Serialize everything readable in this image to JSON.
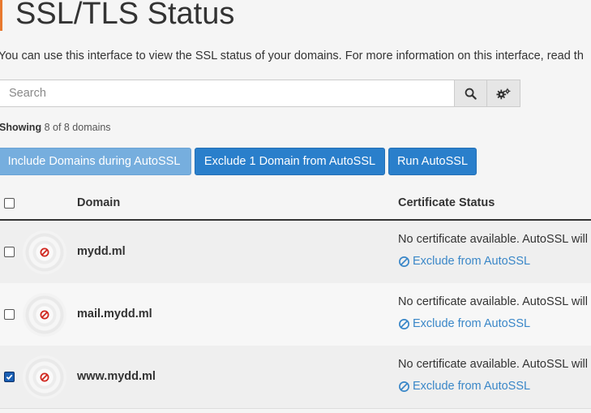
{
  "page": {
    "title": "SSL/TLS Status",
    "intro": "You can use this interface to view the SSL status of your domains. For more information on this interface, read th"
  },
  "search": {
    "placeholder": "Search",
    "search_icon": "search-icon",
    "settings_icon": "gears-icon"
  },
  "summary": {
    "label": "Showing",
    "count": "8 of 8 domains"
  },
  "actions": {
    "include": "Include Domains during AutoSSL",
    "exclude": "Exclude 1 Domain from AutoSSL",
    "run": "Run AutoSSL"
  },
  "table": {
    "headers": {
      "domain": "Domain",
      "status": "Certificate Status"
    },
    "rows": [
      {
        "domain": "mydd.ml",
        "status": "No certificate available. AutoSSL will",
        "link": "Exclude from AutoSSL",
        "checked": false,
        "icon": "prohibited-icon"
      },
      {
        "domain": "mail.mydd.ml",
        "status": "No certificate available. AutoSSL will",
        "link": "Exclude from AutoSSL",
        "checked": false,
        "icon": "prohibited-icon"
      },
      {
        "domain": "www.mydd.ml",
        "status": "No certificate available. AutoSSL will",
        "link": "Exclude from AutoSSL",
        "checked": true,
        "icon": "prohibited-icon"
      }
    ]
  },
  "colors": {
    "accent_bar": "#e8792f",
    "primary_button": "#2a7fcb",
    "disabled_button": "#76aede",
    "link": "#3a87c8",
    "error_icon": "#d0261e"
  }
}
